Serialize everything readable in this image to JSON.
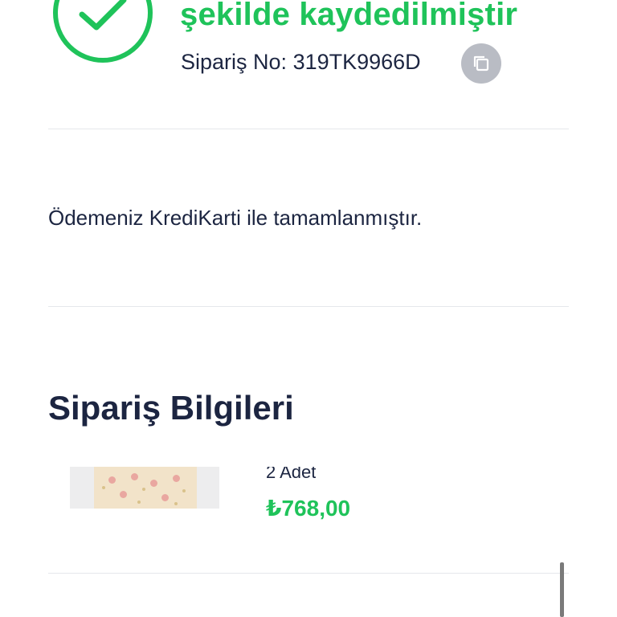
{
  "confirmation": {
    "title": "şekilde kaydedilmiştir",
    "order_label": "Sipariş No:",
    "order_number": "319TK9966D",
    "success_color": "#1fc35a"
  },
  "payment": {
    "message": "Ödemeniz KrediKarti ile tamamlanmıştır."
  },
  "order_info": {
    "section_title": "Sipariş Bilgileri",
    "items": [
      {
        "quantity": "2 Adet",
        "price": "₺768,00"
      }
    ]
  },
  "icons": {
    "status": "check-circle-icon",
    "copy": "copy-icon"
  }
}
